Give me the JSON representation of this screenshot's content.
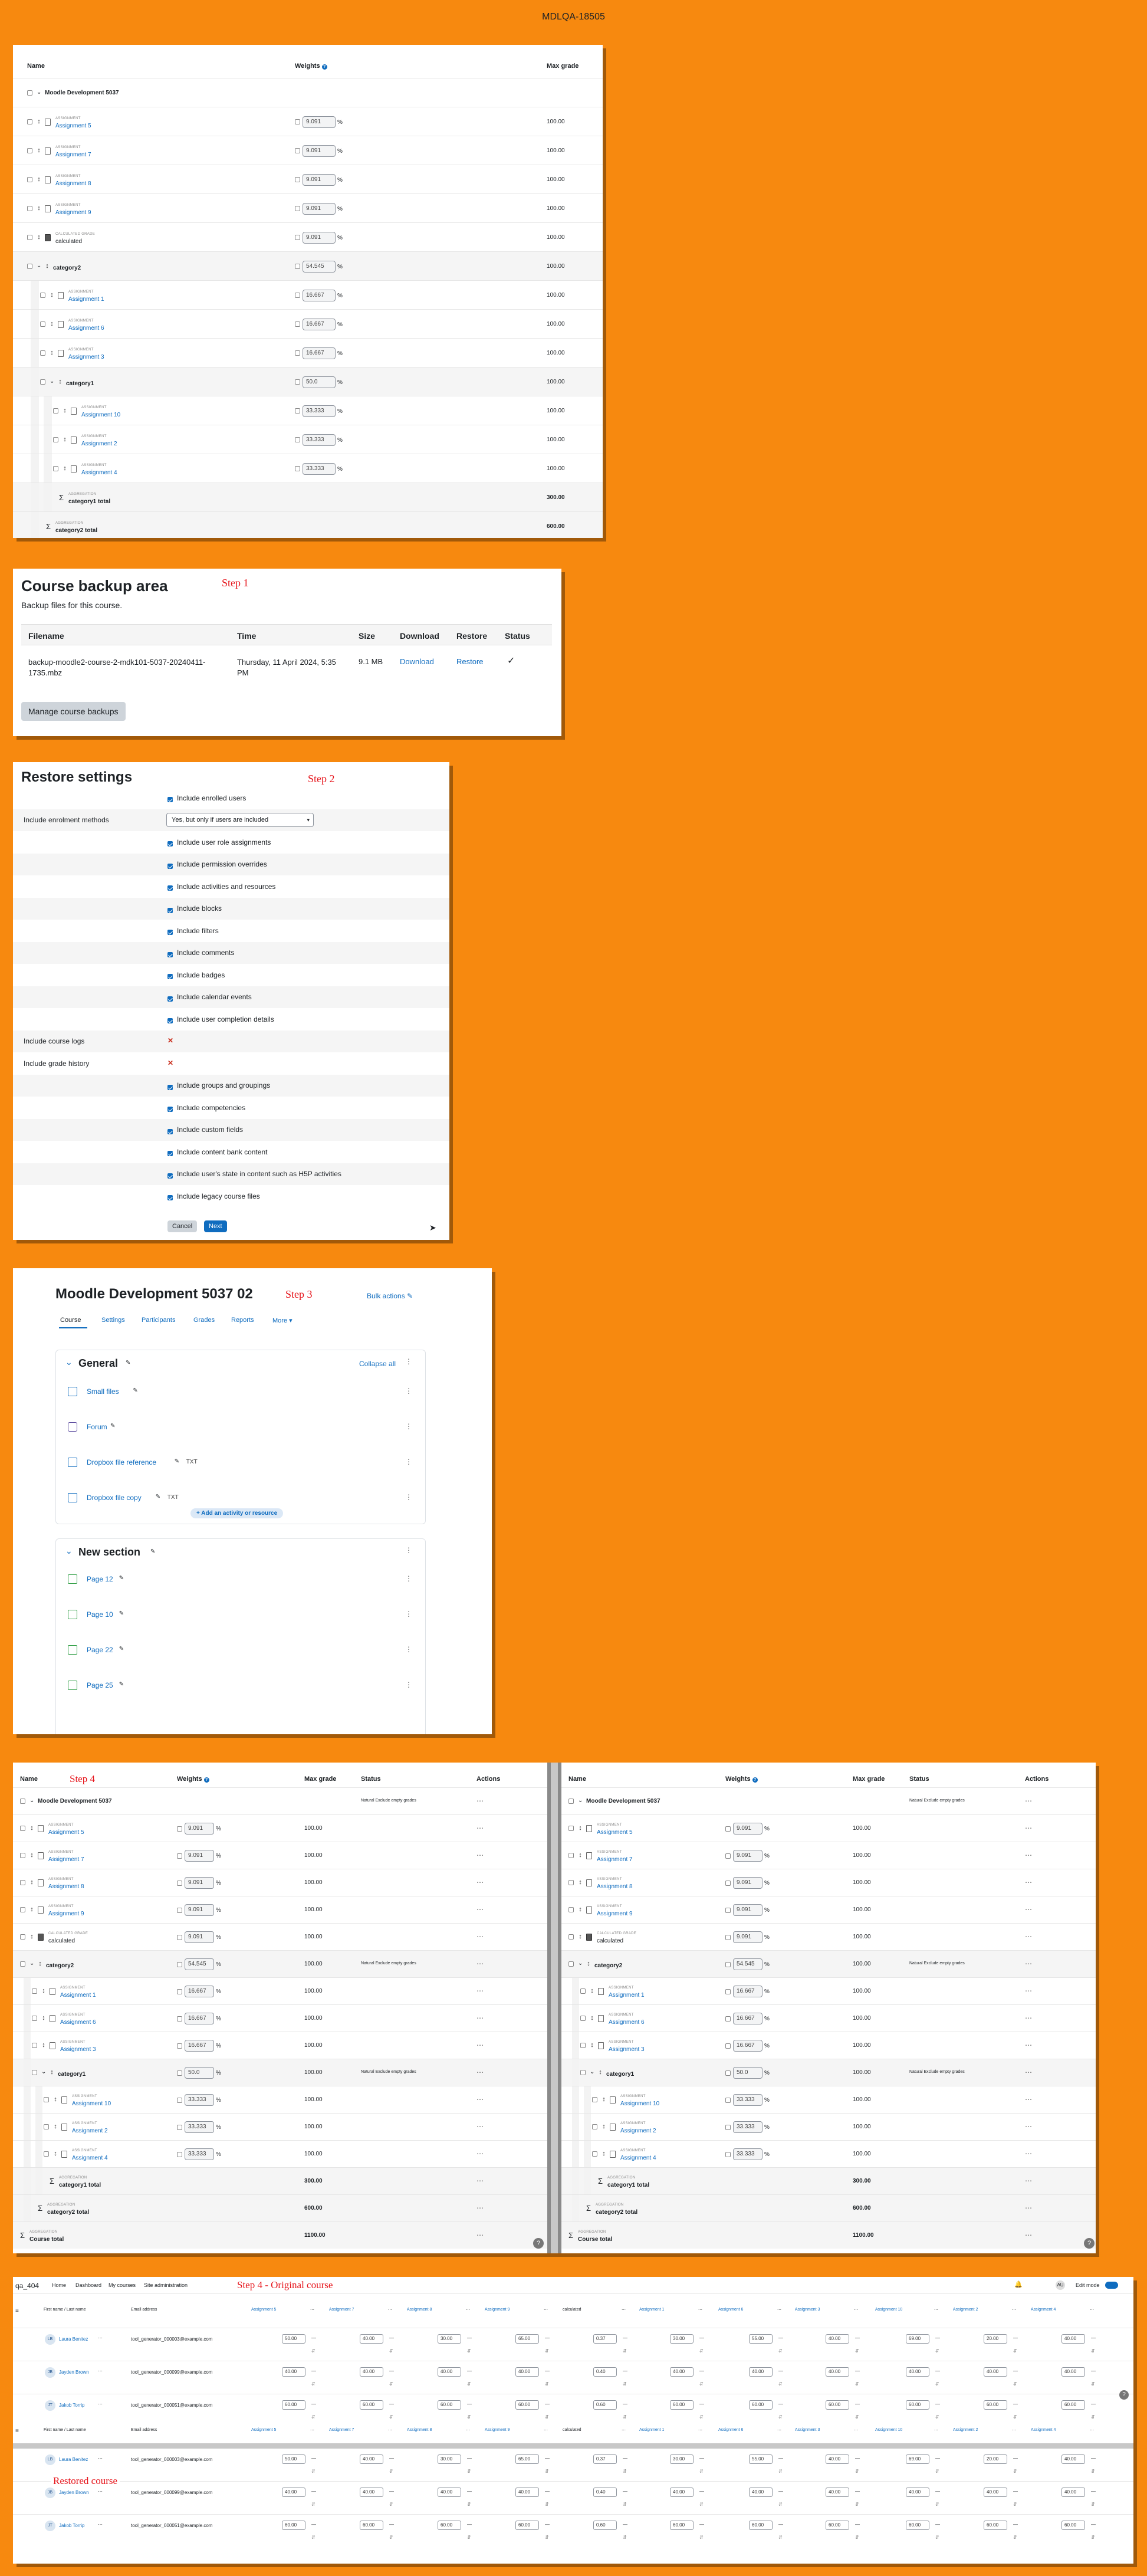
{
  "title": "MDLQA-18505",
  "gradebook": {
    "headers": {
      "name": "Name",
      "weights": "Weights",
      "max": "Max grade",
      "status": "Status",
      "actions": "Actions"
    },
    "course": "Moodle Development 5037",
    "items": [
      {
        "kind": "ASSIGNMENT",
        "name": "Assignment 5",
        "weight": "9.091",
        "max": "100.00",
        "level": 0,
        "type": "assign"
      },
      {
        "kind": "ASSIGNMENT",
        "name": "Assignment 7",
        "weight": "9.091",
        "max": "100.00",
        "level": 0,
        "type": "assign"
      },
      {
        "kind": "ASSIGNMENT",
        "name": "Assignment 8",
        "weight": "9.091",
        "max": "100.00",
        "level": 0,
        "type": "assign"
      },
      {
        "kind": "ASSIGNMENT",
        "name": "Assignment 9",
        "weight": "9.091",
        "max": "100.00",
        "level": 0,
        "type": "assign"
      },
      {
        "kind": "CALCULATED GRADE",
        "name": "calculated",
        "weight": "9.091",
        "max": "100.00",
        "level": 0,
        "type": "calc"
      },
      {
        "kind": "",
        "name": "category2",
        "weight": "54.545",
        "max": "100.00",
        "level": 0,
        "type": "cat"
      },
      {
        "kind": "ASSIGNMENT",
        "name": "Assignment 1",
        "weight": "16.667",
        "max": "100.00",
        "level": 1,
        "type": "assign"
      },
      {
        "kind": "ASSIGNMENT",
        "name": "Assignment 6",
        "weight": "16.667",
        "max": "100.00",
        "level": 1,
        "type": "assign"
      },
      {
        "kind": "ASSIGNMENT",
        "name": "Assignment 3",
        "weight": "16.667",
        "max": "100.00",
        "level": 1,
        "type": "assign"
      },
      {
        "kind": "",
        "name": "category1",
        "weight": "50.0",
        "max": "100.00",
        "level": 1,
        "type": "cat"
      },
      {
        "kind": "ASSIGNMENT",
        "name": "Assignment 10",
        "weight": "33.333",
        "max": "100.00",
        "level": 2,
        "type": "assign"
      },
      {
        "kind": "ASSIGNMENT",
        "name": "Assignment 2",
        "weight": "33.333",
        "max": "100.00",
        "level": 2,
        "type": "assign"
      },
      {
        "kind": "ASSIGNMENT",
        "name": "Assignment 4",
        "weight": "33.333",
        "max": "100.00",
        "level": 2,
        "type": "assign"
      }
    ],
    "totals": [
      {
        "kind": "AGGREGATION",
        "name": "category1 total",
        "max": "300.00",
        "level": 2
      },
      {
        "kind": "AGGREGATION",
        "name": "category2 total",
        "max": "600.00",
        "level": 1
      },
      {
        "kind": "AGGREGATION",
        "name": "Course total",
        "max": "1100.00",
        "level": 0
      }
    ],
    "status_text": "Natural  Exclude empty grades",
    "action_dots": "⋯"
  },
  "backup": {
    "title": "Course backup area",
    "step": "Step 1",
    "subtitle": "Backup files for this course.",
    "cols": [
      "Filename",
      "Time",
      "Size",
      "Download",
      "Restore",
      "Status"
    ],
    "filename": "backup-moodle2-course-2-mdk101-5037-20240411-1735.mbz",
    "time": "Thursday, 11 April 2024, 5:35 PM",
    "size": "9.1 MB",
    "download": "Download",
    "restore": "Restore",
    "manage": "Manage course backups"
  },
  "restore": {
    "title": "Restore settings",
    "step": "Step 2",
    "rows": [
      {
        "label": "",
        "text": "Include enrolled users",
        "type": "check"
      },
      {
        "label": "Include enrolment methods",
        "text": "Yes, but only if users are included",
        "type": "select"
      },
      {
        "label": "",
        "text": "Include user role assignments",
        "type": "check"
      },
      {
        "label": "",
        "text": "Include permission overrides",
        "type": "check"
      },
      {
        "label": "",
        "text": "Include activities and resources",
        "type": "check"
      },
      {
        "label": "",
        "text": "Include blocks",
        "type": "check"
      },
      {
        "label": "",
        "text": "Include filters",
        "type": "check"
      },
      {
        "label": "",
        "text": "Include comments",
        "type": "check"
      },
      {
        "label": "",
        "text": "Include badges",
        "type": "check"
      },
      {
        "label": "",
        "text": "Include calendar events",
        "type": "check"
      },
      {
        "label": "",
        "text": "Include user completion details",
        "type": "check"
      },
      {
        "label": "Include course logs",
        "text": "✕",
        "type": "x"
      },
      {
        "label": "Include grade history",
        "text": "✕",
        "type": "x"
      },
      {
        "label": "",
        "text": "Include groups and groupings",
        "type": "check"
      },
      {
        "label": "",
        "text": "Include competencies",
        "type": "check"
      },
      {
        "label": "",
        "text": "Include custom fields",
        "type": "check"
      },
      {
        "label": "",
        "text": "Include content bank content",
        "type": "check"
      },
      {
        "label": "",
        "text": "Include user's state in content such as H5P activities",
        "type": "check"
      },
      {
        "label": "",
        "text": "Include legacy course files",
        "type": "check"
      }
    ],
    "cancel": "Cancel",
    "next": "Next"
  },
  "course": {
    "title": "Moodle Development 5037 02",
    "step": "Step 3",
    "bulk": "Bulk actions",
    "tabs": [
      "Course",
      "Settings",
      "Participants",
      "Grades",
      "Reports",
      "More"
    ],
    "general": "General",
    "collapse": "Collapse all",
    "general_items": [
      {
        "name": "Small files",
        "type": "file",
        "tag": ""
      },
      {
        "name": "Forum",
        "type": "forum",
        "tag": ""
      },
      {
        "name": "Dropbox file reference",
        "type": "file",
        "tag": "TXT"
      },
      {
        "name": "Dropbox file copy",
        "type": "file",
        "tag": "TXT"
      }
    ],
    "add": "+ Add an activity or resource",
    "new_section": "New section",
    "section_items": [
      "Page 12",
      "Page 10",
      "Page 22",
      "Page 25"
    ]
  },
  "step4": {
    "left_label": "Step 4",
    "original_label": "Step 4 - Original course",
    "restored_label": "Restored course"
  },
  "grader": {
    "site": "qa_404",
    "nav": [
      "Home",
      "Dashboard",
      "My courses",
      "Site administration"
    ],
    "user_initials": "AU",
    "edit_mode": "Edit mode",
    "col_name": "First name / Last name",
    "col_email": "Email address",
    "assign_cols": [
      "Assignment 5",
      "Assignment 7",
      "Assignment 8",
      "Assignment 9",
      "calculated",
      "Assignment 1",
      "Assignment 6",
      "Assignment 3",
      "Assignment 10",
      "Assignment 2",
      "Assignment 4"
    ],
    "students": [
      {
        "initials": "LB",
        "name": "Laura Benitez",
        "email": "tool_generator_000003@example.com",
        "grades": [
          "50.00",
          "40.00",
          "30.00",
          "65.00",
          "0.37",
          "30.00",
          "55.00",
          "40.00",
          "69.00",
          "20.00",
          "40.00"
        ]
      },
      {
        "initials": "JB",
        "name": "Jayden Brown",
        "email": "tool_generator_000099@example.com",
        "grades": [
          "40.00",
          "40.00",
          "40.00",
          "40.00",
          "0.40",
          "40.00",
          "40.00",
          "40.00",
          "40.00",
          "40.00",
          "40.00"
        ]
      },
      {
        "initials": "JT",
        "name": "Jakob Torrip",
        "email": "tool_generator_000051@example.com",
        "grades": [
          "60.00",
          "60.00",
          "60.00",
          "60.00",
          "0.60",
          "60.00",
          "60.00",
          "60.00",
          "60.00",
          "60.00",
          "60.00"
        ]
      }
    ]
  }
}
